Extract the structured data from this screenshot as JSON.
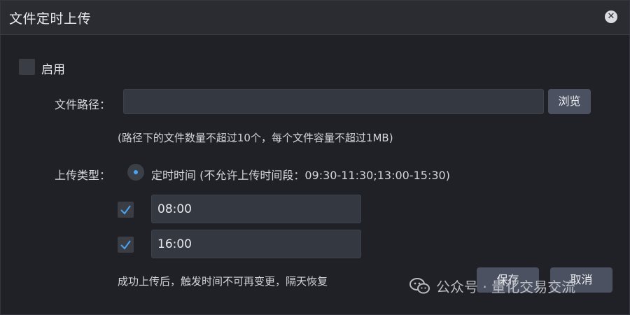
{
  "window": {
    "title": "文件定时上传",
    "close_icon": "close-icon"
  },
  "enable": {
    "label": "启用",
    "checked": false
  },
  "file_path": {
    "label": "文件路径：",
    "value": "",
    "browse_label": "浏览",
    "hint": "(路径下的文件数量不超过10个，每个文件容量不超过1MB)"
  },
  "upload_type": {
    "label": "上传类型：",
    "option_label": "定时时间 (不允许上传时间段：09:30-11:30;13:00-15:30)",
    "selected": true
  },
  "times": [
    {
      "checked": true,
      "value": "08:00"
    },
    {
      "checked": true,
      "value": "16:00"
    }
  ],
  "footer": {
    "note": "成功上传后，触发时间不可再变更，隔天恢复",
    "save_label": "保存",
    "cancel_label": "取消"
  },
  "watermark": {
    "text": "公众号 · 量化交易交流",
    "icon": "wechat-icon"
  },
  "colors": {
    "background": "#1f2126",
    "titlebar": "#2a2c31",
    "input": "#343840",
    "button": "#4b5160",
    "accent": "#4aa3f2"
  }
}
